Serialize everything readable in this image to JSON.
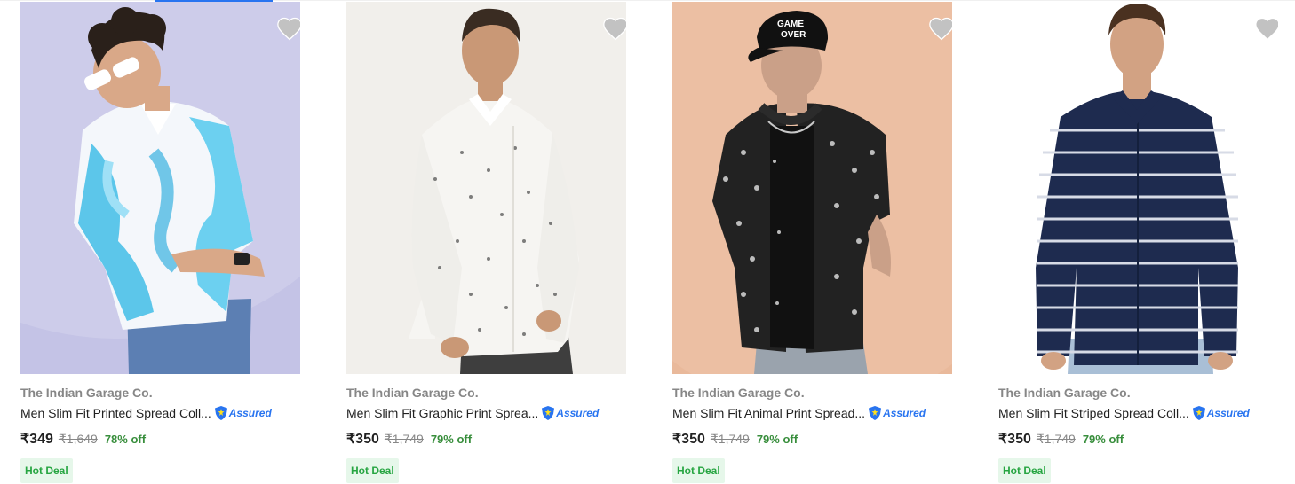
{
  "colors": {
    "brand_text": "#878787",
    "title_text": "#212121",
    "discount": "#388e3c",
    "assured": "#2874f0",
    "deal_bg": "#e6f7ea",
    "deal_text": "#26a541",
    "wishlist": "#c2c2c2"
  },
  "icons": {
    "wishlist": "heart-icon",
    "assured": "flipkart-assured-shield-icon"
  },
  "products": [
    {
      "brand": "The Indian Garage Co.",
      "title": "Men Slim Fit Printed Spread Coll...",
      "assured_label": "Assured",
      "price": "₹349",
      "mrp": "₹1,649",
      "discount": "78% off",
      "deal": "Hot Deal"
    },
    {
      "brand": "The Indian Garage Co.",
      "title": "Men Slim Fit Graphic Print Sprea...",
      "assured_label": "Assured",
      "price": "₹350",
      "mrp": "₹1,749",
      "discount": "79% off",
      "deal": "Hot Deal"
    },
    {
      "brand": "The Indian Garage Co.",
      "title": "Men Slim Fit Animal Print Spread...",
      "assured_label": "Assured",
      "price": "₹350",
      "mrp": "₹1,749",
      "discount": "79% off",
      "deal": "Hot Deal"
    },
    {
      "brand": "The Indian Garage Co.",
      "title": "Men Slim Fit Striped Spread Coll...",
      "assured_label": "Assured",
      "price": "₹350",
      "mrp": "₹1,749",
      "discount": "79% off",
      "deal": "Hot Deal"
    }
  ]
}
